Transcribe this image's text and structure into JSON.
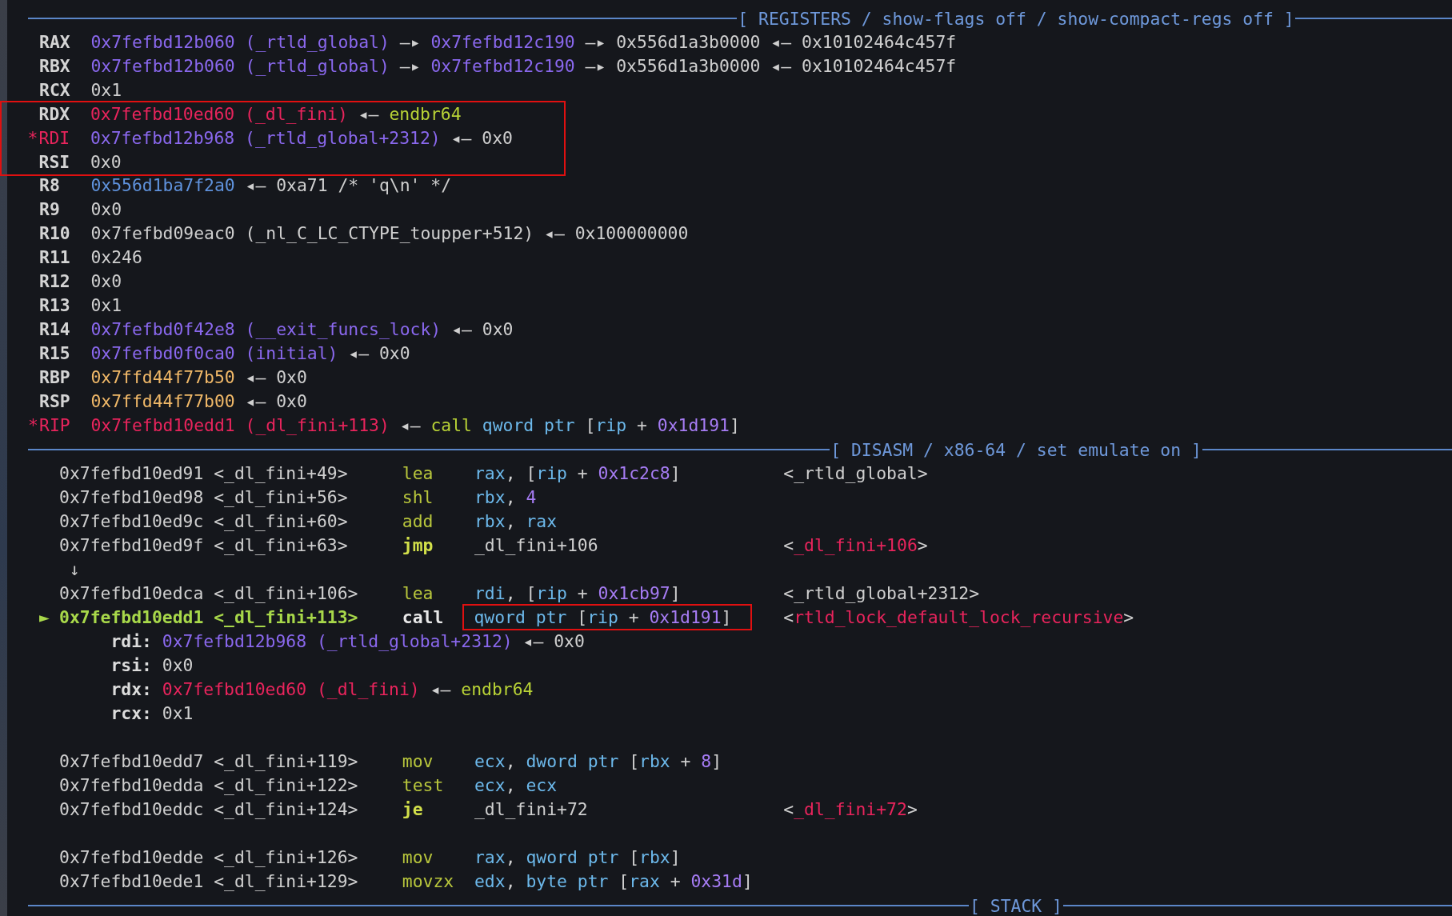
{
  "registers_header": "[ REGISTERS / show-flags off / show-compact-regs off ]",
  "registers": [
    {
      "name": "RAX",
      "changed": false,
      "boxed": false,
      "segments": [
        {
          "text": "0x7fefbd12b060 (_rtld_global)",
          "kind": "data"
        },
        {
          "text": " —▸ ",
          "kind": "plain"
        },
        {
          "text": "0x7fefbd12c190",
          "kind": "data"
        },
        {
          "text": " —▸ 0x556d1a3b0000 ◂— 0x10102464c457f",
          "kind": "plain"
        }
      ]
    },
    {
      "name": "RBX",
      "changed": false,
      "boxed": false,
      "segments": [
        {
          "text": "0x7fefbd12b060 (_rtld_global)",
          "kind": "data"
        },
        {
          "text": " —▸ ",
          "kind": "plain"
        },
        {
          "text": "0x7fefbd12c190",
          "kind": "data"
        },
        {
          "text": " —▸ 0x556d1a3b0000 ◂— 0x10102464c457f",
          "kind": "plain"
        }
      ]
    },
    {
      "name": "RCX",
      "changed": false,
      "boxed": false,
      "segments": [
        {
          "text": "0x1",
          "kind": "plain"
        }
      ]
    },
    {
      "name": "RDX",
      "changed": false,
      "boxed": true,
      "segments": [
        {
          "text": "0x7fefbd10ed60 (_dl_fini)",
          "kind": "code"
        },
        {
          "text": " ◂— ",
          "kind": "plain"
        },
        {
          "text": "endbr64",
          "kind": "insn"
        }
      ]
    },
    {
      "name": "RDI",
      "changed": true,
      "marker": "*",
      "boxed": true,
      "segments": [
        {
          "text": "0x7fefbd12b968 (_rtld_global+2312)",
          "kind": "data"
        },
        {
          "text": " ◂— 0x0",
          "kind": "plain"
        }
      ]
    },
    {
      "name": "RSI",
      "changed": false,
      "boxed": true,
      "segments": [
        {
          "text": "0x0",
          "kind": "plain"
        }
      ]
    },
    {
      "name": "R8",
      "changed": false,
      "boxed": false,
      "segments": [
        {
          "text": "0x556d1ba7f2a0",
          "kind": "heap"
        },
        {
          "text": " ◂— 0xa71 /* 'q\\n' */",
          "kind": "plain"
        }
      ]
    },
    {
      "name": "R9",
      "changed": false,
      "boxed": false,
      "segments": [
        {
          "text": "0x0",
          "kind": "plain"
        }
      ]
    },
    {
      "name": "R10",
      "changed": false,
      "boxed": false,
      "segments": [
        {
          "text": "0x7fefbd09eac0 (_nl_C_LC_CTYPE_toupper+512) ◂— 0x100000000",
          "kind": "plain"
        }
      ]
    },
    {
      "name": "R11",
      "changed": false,
      "boxed": false,
      "segments": [
        {
          "text": "0x246",
          "kind": "plain"
        }
      ]
    },
    {
      "name": "R12",
      "changed": false,
      "boxed": false,
      "segments": [
        {
          "text": "0x0",
          "kind": "plain"
        }
      ]
    },
    {
      "name": "R13",
      "changed": false,
      "boxed": false,
      "segments": [
        {
          "text": "0x1",
          "kind": "plain"
        }
      ]
    },
    {
      "name": "R14",
      "changed": false,
      "boxed": false,
      "segments": [
        {
          "text": "0x7fefbd0f42e8 (__exit_funcs_lock)",
          "kind": "data"
        },
        {
          "text": " ◂— 0x0",
          "kind": "plain"
        }
      ]
    },
    {
      "name": "R15",
      "changed": false,
      "boxed": false,
      "segments": [
        {
          "text": "0x7fefbd0f0ca0 (initial)",
          "kind": "data"
        },
        {
          "text": " ◂— 0x0",
          "kind": "plain"
        }
      ]
    },
    {
      "name": "RBP",
      "changed": false,
      "boxed": false,
      "segments": [
        {
          "text": "0x7ffd44f77b50",
          "kind": "stack"
        },
        {
          "text": " ◂— 0x0",
          "kind": "plain"
        }
      ]
    },
    {
      "name": "RSP",
      "changed": false,
      "boxed": false,
      "segments": [
        {
          "text": "0x7ffd44f77b00",
          "kind": "stack"
        },
        {
          "text": " ◂— 0x0",
          "kind": "plain"
        }
      ]
    },
    {
      "name": "RIP",
      "changed": true,
      "marker": "*",
      "boxed": false,
      "segments": [
        {
          "text": "0x7fefbd10edd1 (_dl_fini+113)",
          "kind": "code"
        },
        {
          "text": " ◂— ",
          "kind": "plain"
        },
        {
          "text": "call",
          "kind": "insn"
        },
        {
          "text": " qword ptr",
          "kind": "reg"
        },
        {
          "text": " [",
          "kind": "plain"
        },
        {
          "text": "rip",
          "kind": "reg"
        },
        {
          "text": " + ",
          "kind": "plain"
        },
        {
          "text": "0x1d191",
          "kind": "num"
        },
        {
          "text": "]",
          "kind": "plain"
        }
      ]
    }
  ],
  "disasm_header": "[ DISASM / x86-64 / set emulate on ]",
  "disasm": [
    {
      "kind": "insn",
      "current": false,
      "address": "0x7fefbd10ed91",
      "symbol": "<_dl_fini+49>",
      "mnemonic": {
        "text": "lea",
        "kind": "mnem"
      },
      "boxed": false,
      "operands": [
        {
          "text": "rax",
          "kind": "reg"
        },
        {
          "text": ", [",
          "kind": "plain"
        },
        {
          "text": "rip",
          "kind": "reg"
        },
        {
          "text": " + ",
          "kind": "plain"
        },
        {
          "text": "0x1c2c8",
          "kind": "num"
        },
        {
          "text": "]",
          "kind": "plain"
        }
      ],
      "comment": [
        {
          "text": "<_rtld_global>",
          "kind": "plain"
        }
      ]
    },
    {
      "kind": "insn",
      "current": false,
      "address": "0x7fefbd10ed98",
      "symbol": "<_dl_fini+56>",
      "mnemonic": {
        "text": "shl",
        "kind": "mnem"
      },
      "boxed": false,
      "operands": [
        {
          "text": "rbx",
          "kind": "reg"
        },
        {
          "text": ", ",
          "kind": "plain"
        },
        {
          "text": "4",
          "kind": "num"
        }
      ]
    },
    {
      "kind": "insn",
      "current": false,
      "address": "0x7fefbd10ed9c",
      "symbol": "<_dl_fini+60>",
      "mnemonic": {
        "text": "add",
        "kind": "mnem"
      },
      "boxed": false,
      "operands": [
        {
          "text": "rbx",
          "kind": "reg"
        },
        {
          "text": ", ",
          "kind": "plain"
        },
        {
          "text": "rax",
          "kind": "reg"
        }
      ]
    },
    {
      "kind": "insn",
      "current": false,
      "address": "0x7fefbd10ed9f",
      "symbol": "<_dl_fini+63>",
      "mnemonic": {
        "text": "jmp",
        "kind": "branch"
      },
      "boxed": false,
      "operands": [
        {
          "text": "_dl_fini+106",
          "kind": "plain"
        }
      ],
      "comment": [
        {
          "text": "<",
          "kind": "plain"
        },
        {
          "text": "_dl_fini+106",
          "kind": "code"
        },
        {
          "text": ">",
          "kind": "plain"
        }
      ]
    },
    {
      "kind": "jump",
      "text": "↓"
    },
    {
      "kind": "insn",
      "current": false,
      "address": "0x7fefbd10edca",
      "symbol": "<_dl_fini+106>",
      "mnemonic": {
        "text": "lea",
        "kind": "mnem"
      },
      "boxed": false,
      "operands": [
        {
          "text": "rdi",
          "kind": "reg"
        },
        {
          "text": ", [",
          "kind": "plain"
        },
        {
          "text": "rip",
          "kind": "reg"
        },
        {
          "text": " + ",
          "kind": "plain"
        },
        {
          "text": "0x1cb97",
          "kind": "num"
        },
        {
          "text": "]",
          "kind": "plain"
        }
      ],
      "comment": [
        {
          "text": "<_rtld_global+2312>",
          "kind": "plain"
        }
      ]
    },
    {
      "kind": "insn",
      "current": true,
      "marker": "►",
      "address": "0x7fefbd10edd1",
      "symbol": "<_dl_fini+113>",
      "mnemonic": {
        "text": "call",
        "kind": "call"
      },
      "boxed": true,
      "operands": [
        {
          "text": "qword ptr",
          "kind": "reg"
        },
        {
          "text": " [",
          "kind": "plain"
        },
        {
          "text": "rip",
          "kind": "reg"
        },
        {
          "text": " + ",
          "kind": "plain"
        },
        {
          "text": "0x1d191",
          "kind": "num"
        },
        {
          "text": "]",
          "kind": "plain"
        }
      ],
      "comment": [
        {
          "text": "<",
          "kind": "plain"
        },
        {
          "text": "rtld_lock_default_lock_recursive",
          "kind": "code"
        },
        {
          "text": ">",
          "kind": "plain"
        }
      ]
    },
    {
      "kind": "arg",
      "name": "rdi:",
      "segments": [
        {
          "text": "0x7fefbd12b968 (_rtld_global+2312)",
          "kind": "data"
        },
        {
          "text": " ◂— 0x0",
          "kind": "plain"
        }
      ]
    },
    {
      "kind": "arg",
      "name": "rsi:",
      "segments": [
        {
          "text": "0x0",
          "kind": "plain"
        }
      ]
    },
    {
      "kind": "arg",
      "name": "rdx:",
      "segments": [
        {
          "text": "0x7fefbd10ed60 (_dl_fini)",
          "kind": "code"
        },
        {
          "text": " ◂— ",
          "kind": "plain"
        },
        {
          "text": "endbr64",
          "kind": "insn"
        }
      ]
    },
    {
      "kind": "arg",
      "name": "rcx:",
      "segments": [
        {
          "text": "0x1",
          "kind": "plain"
        }
      ]
    },
    {
      "kind": "blank"
    },
    {
      "kind": "insn",
      "current": false,
      "address": "0x7fefbd10edd7",
      "symbol": "<_dl_fini+119>",
      "mnemonic": {
        "text": "mov",
        "kind": "mnem"
      },
      "boxed": false,
      "operands": [
        {
          "text": "ecx",
          "kind": "reg"
        },
        {
          "text": ", ",
          "kind": "plain"
        },
        {
          "text": "dword ptr",
          "kind": "reg"
        },
        {
          "text": " [",
          "kind": "plain"
        },
        {
          "text": "rbx",
          "kind": "reg"
        },
        {
          "text": " + ",
          "kind": "plain"
        },
        {
          "text": "8",
          "kind": "num"
        },
        {
          "text": "]",
          "kind": "plain"
        }
      ]
    },
    {
      "kind": "insn",
      "current": false,
      "address": "0x7fefbd10edda",
      "symbol": "<_dl_fini+122>",
      "mnemonic": {
        "text": "test",
        "kind": "mnem"
      },
      "boxed": false,
      "operands": [
        {
          "text": "ecx",
          "kind": "reg"
        },
        {
          "text": ", ",
          "kind": "plain"
        },
        {
          "text": "ecx",
          "kind": "reg"
        }
      ]
    },
    {
      "kind": "insn",
      "current": false,
      "address": "0x7fefbd10eddc",
      "symbol": "<_dl_fini+124>",
      "mnemonic": {
        "text": "je",
        "kind": "branch"
      },
      "boxed": false,
      "operands": [
        {
          "text": "_dl_fini+72",
          "kind": "plain"
        }
      ],
      "comment": [
        {
          "text": "<",
          "kind": "plain"
        },
        {
          "text": "_dl_fini+72",
          "kind": "code"
        },
        {
          "text": ">",
          "kind": "plain"
        }
      ]
    },
    {
      "kind": "blank"
    },
    {
      "kind": "insn",
      "current": false,
      "address": "0x7fefbd10edde",
      "symbol": "<_dl_fini+126>",
      "mnemonic": {
        "text": "mov",
        "kind": "mnem"
      },
      "boxed": false,
      "operands": [
        {
          "text": "rax",
          "kind": "reg"
        },
        {
          "text": ", ",
          "kind": "plain"
        },
        {
          "text": "qword ptr",
          "kind": "reg"
        },
        {
          "text": " [",
          "kind": "plain"
        },
        {
          "text": "rbx",
          "kind": "reg"
        },
        {
          "text": "]",
          "kind": "plain"
        }
      ]
    },
    {
      "kind": "insn",
      "current": false,
      "address": "0x7fefbd10ede1",
      "symbol": "<_dl_fini+129>",
      "mnemonic": {
        "text": "movzx",
        "kind": "mnem"
      },
      "boxed": false,
      "operands": [
        {
          "text": "edx",
          "kind": "reg"
        },
        {
          "text": ", ",
          "kind": "plain"
        },
        {
          "text": "byte ptr",
          "kind": "reg"
        },
        {
          "text": " [",
          "kind": "plain"
        },
        {
          "text": "rax",
          "kind": "reg"
        },
        {
          "text": " + ",
          "kind": "plain"
        },
        {
          "text": "0x31d",
          "kind": "num"
        },
        {
          "text": "]",
          "kind": "plain"
        }
      ]
    }
  ],
  "stack_header": "[ STACK ]"
}
